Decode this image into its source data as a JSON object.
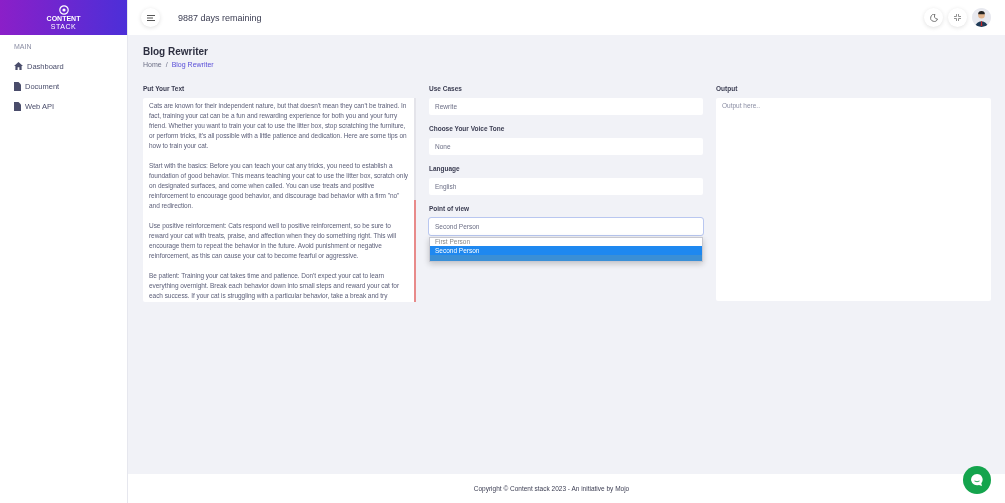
{
  "logo": {
    "line_1": "CONTENT",
    "line_2": "STACK"
  },
  "topbar": {
    "days_remaining": "9887 days remaining"
  },
  "sidebar": {
    "section": "MAIN",
    "items": [
      {
        "label": "Dashboard",
        "kind": "home",
        "selected": false
      },
      {
        "label": "Document",
        "kind": "file",
        "selected": false
      },
      {
        "label": "Web API",
        "kind": "file",
        "selected": false
      }
    ]
  },
  "page": {
    "title": "Blog Rewriter",
    "breadcrumb_separator": "/",
    "breadcrumb": [
      {
        "label": "Home",
        "selected": false
      },
      {
        "label": "Blog Rewriter",
        "selected": true
      }
    ]
  },
  "input": {
    "label": "Put Your Text",
    "paragraphs": [
      "Cats are known for their independent nature, but that doesn't mean they can't be trained. In fact, training your cat can be a fun and rewarding experience for both you and your furry friend. Whether you want to train your cat to use the litter box, stop scratching the furniture, or perform tricks, it's all possible with a little patience and dedication. Here are some tips on how to train your cat.",
      "Start with the basics: Before you can teach your cat any tricks, you need to establish a foundation of good behavior. This means teaching your cat to use the litter box, scratch only on designated surfaces, and come when called. You can use treats and positive reinforcement to encourage good behavior, and discourage bad behavior with a firm \"no\" and redirection.",
      "Use positive reinforcement: Cats respond well to positive reinforcement, so be sure to reward your cat with treats, praise, and affection when they do something right. This will encourage them to repeat the behavior in the future. Avoid punishment or negative reinforcement, as this can cause your cat to become fearful or aggressive.",
      "Be patient: Training your cat takes time and patience. Don't expect your cat to learn everything overnight. Break each behavior down into small steps and reward your cat for each success. If your cat is struggling with a particular behavior, take a break and try"
    ]
  },
  "options": [
    {
      "label": "Use Cases",
      "value": "Rewrite"
    },
    {
      "label": "Choose Your Voice Tone",
      "value": "None"
    },
    {
      "label": "Language",
      "value": "English"
    },
    {
      "label": "Point of view",
      "value": "Second Person",
      "expanded": true,
      "choices": [
        {
          "label": "First Person",
          "selected": false
        },
        {
          "label": "Second Person",
          "selected": true
        }
      ]
    }
  ],
  "output": {
    "label": "Output",
    "placeholder": "Output here.."
  },
  "footer": {
    "text": "Copyright © Content stack 2023 - An initiative by Mojo"
  }
}
